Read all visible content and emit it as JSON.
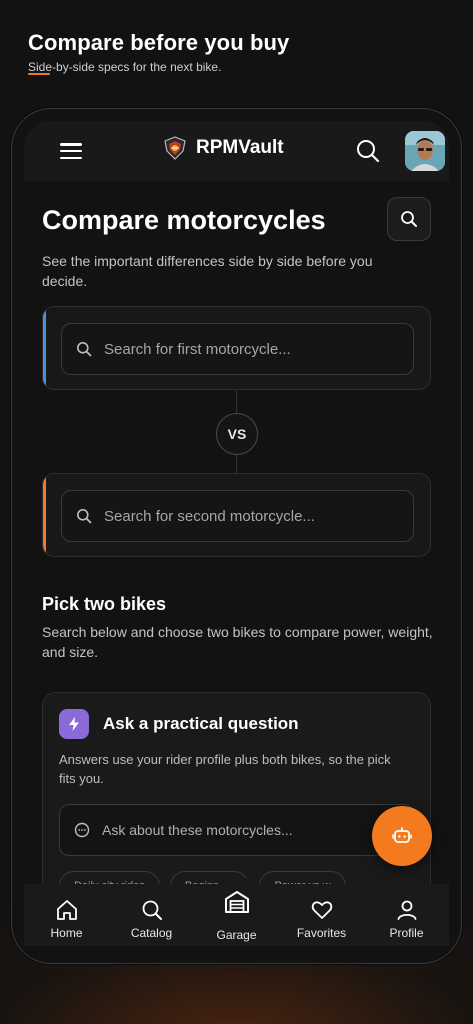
{
  "promo": {
    "title": "Compare before you buy",
    "subtitle": "Side-by-side specs for the next bike."
  },
  "header": {
    "brand": "RPMVault"
  },
  "page": {
    "title": "Compare motorcycles",
    "description": "See the important differences side by side before you decide."
  },
  "compare": {
    "first_placeholder": "Search for first motorcycle...",
    "second_placeholder": "Search for second motorcycle...",
    "vs_label": "VS",
    "first_accent": "#4a90e2",
    "second_accent": "#f07a2b"
  },
  "pick": {
    "title": "Pick two bikes",
    "description": "Search below and choose two bikes to compare power, weight, and size."
  },
  "ask": {
    "title": "Ask a practical question",
    "description": "Answers use your rider profile plus both bikes, so the pick fits you.",
    "placeholder": "Ask about these motorcycles...",
    "chips": [
      "Daily city rides",
      "Beginners",
      "Power vs w"
    ]
  },
  "nav": {
    "items": [
      {
        "label": "Home",
        "icon": "home-icon"
      },
      {
        "label": "Catalog",
        "icon": "search-icon"
      },
      {
        "label": "Garage",
        "icon": "garage-icon"
      },
      {
        "label": "Favorites",
        "icon": "heart-icon"
      },
      {
        "label": "Profile",
        "icon": "user-icon"
      }
    ]
  },
  "colors": {
    "accent": "#f47a20",
    "ask_icon_bg": "#8b6ad8",
    "background": "#121212"
  }
}
